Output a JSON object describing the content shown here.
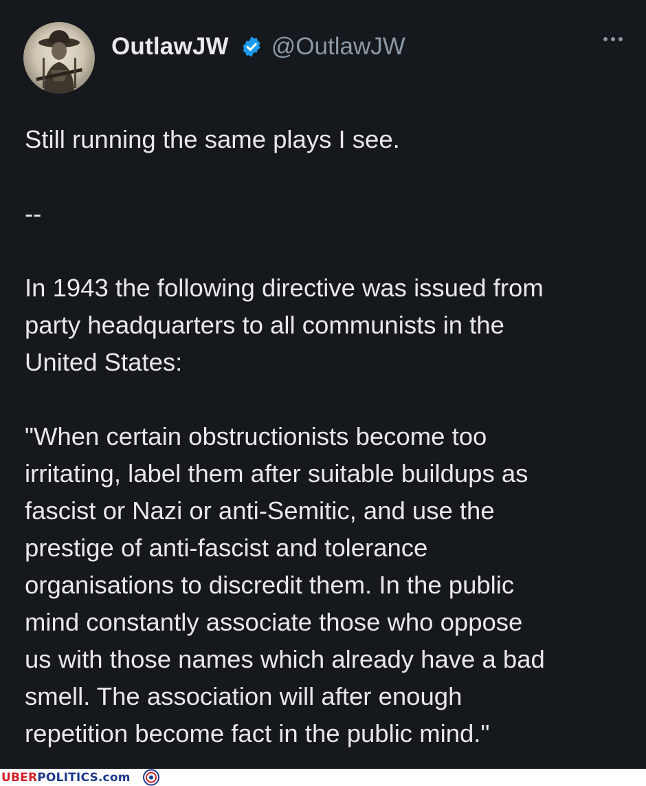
{
  "author": {
    "display_name": "OutlawJW",
    "handle": "@OutlawJW",
    "verified": true,
    "verified_color": "#1d9bf0",
    "avatar_icon": "avatar-cowboy"
  },
  "more_icon": "more-horizontal-icon",
  "tweet": {
    "text": "Still running the same plays I see.\n\n--\n\nIn 1943 the following directive was issued from\nparty headquarters to all communists in the\nUnited States:\n\n\"When certain obstructionists become too\nirritating, label them after suitable buildups as\nfascist or Nazi or anti-Semitic, and use the\nprestige of anti-fascist and tolerance\norganisations to discredit them. In the public\nmind constantly associate those who oppose\nus with those names which already have a bad\nsmell. The association will after enough\nrepetition become fact in the public mind.\""
  },
  "watermark": {
    "part1": "UBER",
    "part2": "POLITICS.com"
  },
  "colors": {
    "background": "#15181d",
    "text": "#e7e9ea",
    "secondary_text": "#8b98a5"
  }
}
